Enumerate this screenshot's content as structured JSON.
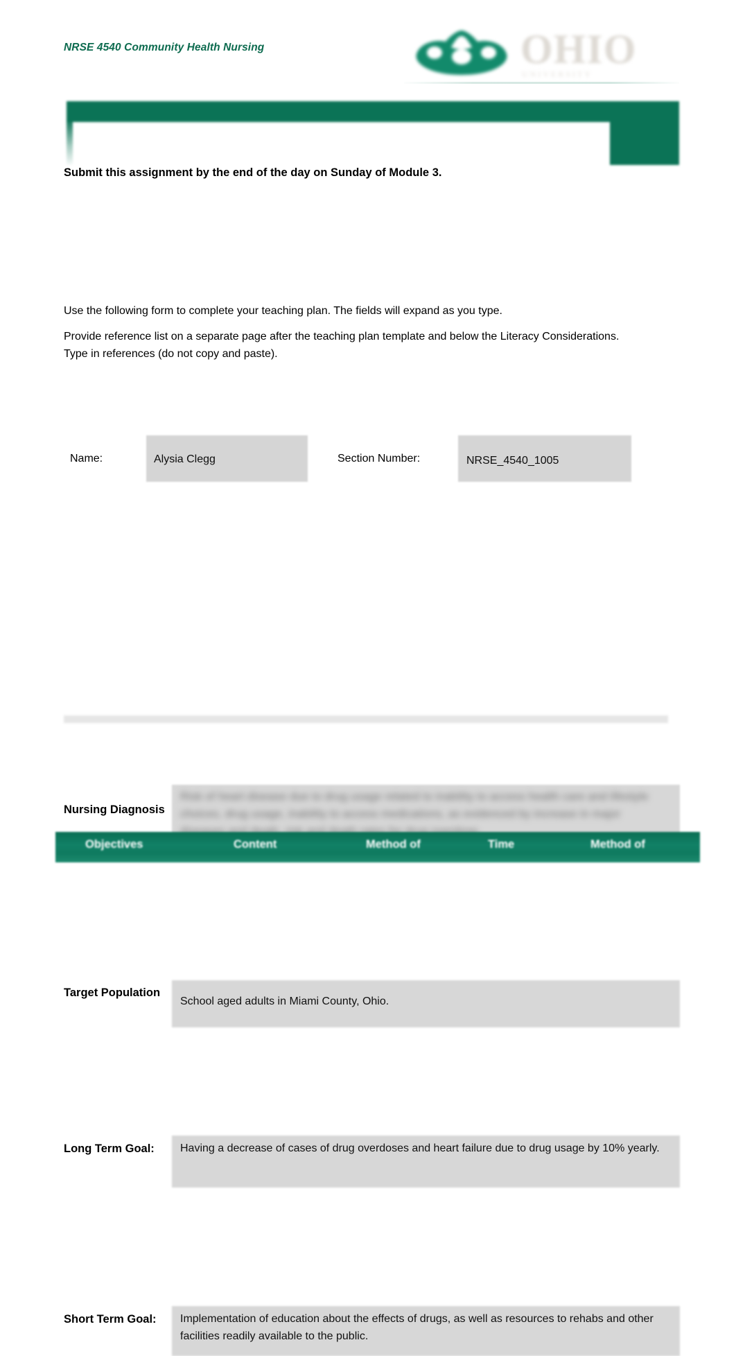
{
  "header": {
    "course_title": "NRSE 4540 Community Health Nursing",
    "logo": {
      "mark": "ohio-bobcat-logo",
      "wordmark": "OHIO",
      "subtitle": "UNIVERSITY"
    }
  },
  "instructions": {
    "submit_line": "Submit this assignment by the end of the day on Sunday of Module 3.",
    "paragraph_1": "Use the following form to complete your teaching plan. The fields will expand as you type.",
    "paragraph_2": "Provide reference list on a separate page after the teaching plan template and below the Literacy Considerations.  Type in references (do not copy and paste)."
  },
  "identity": {
    "name_label": "Name:",
    "name_value": "Alysia Clegg",
    "section_label": "Section Number:",
    "section_value": "NRSE_4540_1005"
  },
  "form_rows": [
    {
      "label": "Nursing Diagnosis",
      "value": "Risk of heart disease due to drug usage related to inability to access health care and lifestyle choices, drug usage, inability to access medications, as evidenced by increase in major diseases and death, risk and death rates for drug overdose."
    },
    {
      "label": "Target Population",
      "value": "School aged adults in Miami County, Ohio."
    },
    {
      "label": "Long Term Goal:",
      "value": "Having a decrease of cases of drug overdoses and heart failure due to drug usage by 10% yearly."
    },
    {
      "label": "Short Term Goal:",
      "value": "Implementation of education about the effects of drugs, as well as resources to rehabs and other facilities readily available to the public."
    }
  ],
  "plan_table": {
    "columns": [
      "Objectives",
      "Content",
      "Method of",
      "Time",
      "Method of"
    ]
  },
  "colors": {
    "brand_green": "#0b7356",
    "header_text_green": "#0d6b4f",
    "field_gray": "#d5d5d5",
    "divider_gray": "#e6e6e6"
  }
}
